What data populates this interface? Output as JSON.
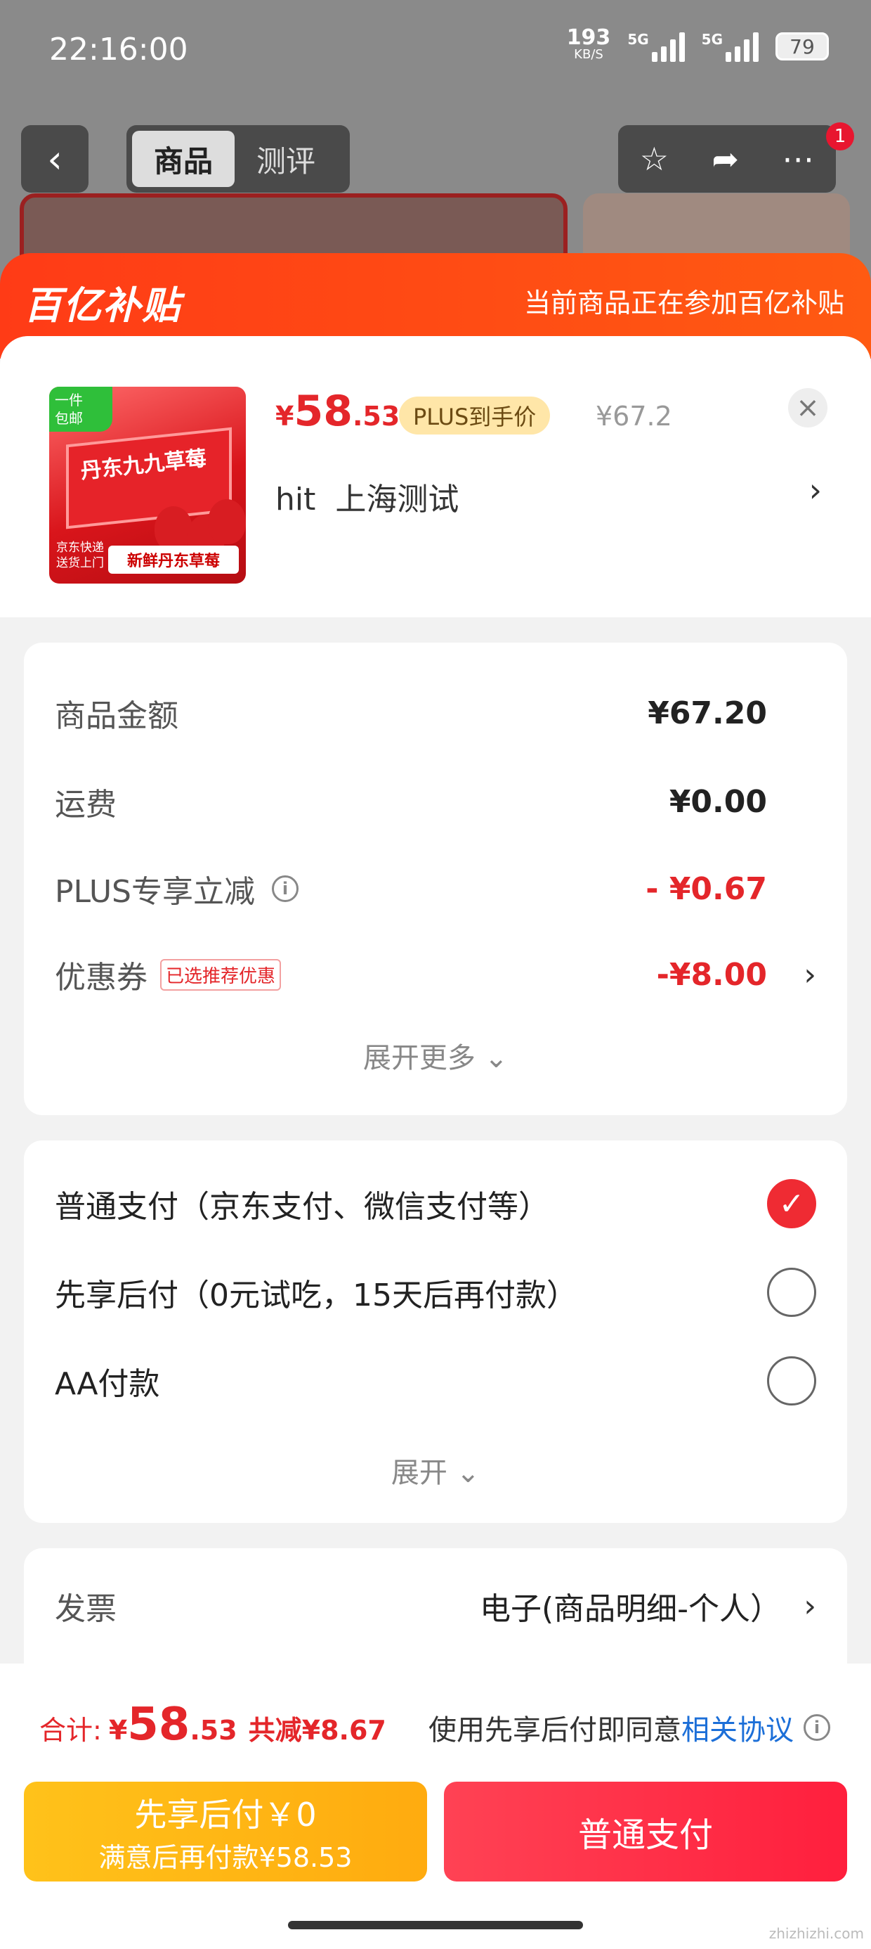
{
  "status_bar": {
    "time": "22:16:00",
    "net_speed": "193",
    "net_unit": "KB/S",
    "sig1": "5G",
    "sig2": "5G",
    "battery": "79"
  },
  "topbar": {
    "tab_goods": "商品",
    "tab_review": "测评",
    "badge": "1"
  },
  "banner": {
    "logo": "百亿补贴",
    "note": "当前商品正在参加百亿补贴"
  },
  "product": {
    "tag_line1": "一件",
    "tag_line2": "包邮",
    "box_text": "丹东九九草莓",
    "img_side": "京东快递\n送货上门",
    "img_label": "新鲜丹东草莓",
    "price_symbol": "¥",
    "price_int": "58",
    "price_dec": ".53",
    "plus_label": "PLUS到手价",
    "orig_price": "¥67.2",
    "spec": "hit  上海测试"
  },
  "costs": {
    "rows": [
      {
        "label": "商品金额",
        "value": "¥67.20"
      },
      {
        "label": "运费",
        "value": "¥0.00"
      },
      {
        "label": "PLUS专享立减",
        "value": "- ¥0.67"
      },
      {
        "label": "优惠券",
        "chip": "已选推荐优惠",
        "value": "-¥8.00"
      }
    ],
    "more": "展开更多"
  },
  "payment": {
    "options": [
      {
        "label": "普通支付（京东支付、微信支付等）",
        "selected": true
      },
      {
        "label": "先享后付（0元试吃，15天后再付款）",
        "selected": false
      },
      {
        "label": "AA付款",
        "selected": false
      }
    ],
    "expand": "展开"
  },
  "invoice": {
    "label": "发票",
    "value": "电子(商品明细-个人）"
  },
  "footer": {
    "total_label": "合计:",
    "total_symbol": "¥",
    "total_int": "58",
    "total_dec": ".53",
    "saved": "共减¥8.67",
    "agree_text": "使用先享后付即同意",
    "agree_link": "相关协议",
    "btn_later_line1": "先享后付￥0",
    "btn_later_line2": "满意后再付款¥58.53",
    "btn_pay": "普通支付"
  },
  "watermark": "zhizhizhi.com",
  "colors": {
    "accent_red": "#e4262a",
    "banner": "#ff3b16",
    "later_btn": "#ffb814",
    "pay_btn": "#ff2f45"
  }
}
